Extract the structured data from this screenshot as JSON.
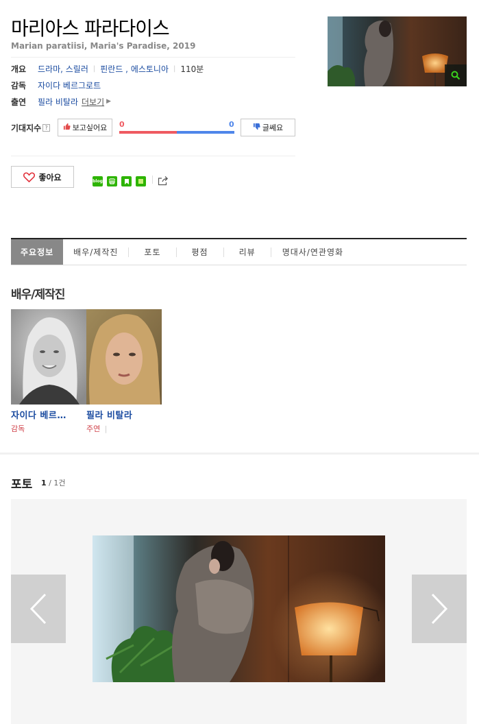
{
  "movie": {
    "title": "마리아스 파라다이스",
    "subtitle": "Marian paratiisi, Maria's Paradise, 2019"
  },
  "info": {
    "overview_label": "개요",
    "genre": "드라마, 스릴러",
    "country": "핀란드 , 에스토니아",
    "runtime": "110분",
    "director_label": "감독",
    "director": "자이다 베르그로트",
    "cast_label": "출연",
    "cast": "필라 비탈라",
    "more_label": "더보기"
  },
  "expectation": {
    "label": "기대지수",
    "help": "?",
    "want_label": "보고싶어요",
    "meh_label": "글쎄요",
    "want_count": "0",
    "meh_count": "0",
    "want_ratio": 0.5
  },
  "actions": {
    "like_label": "좋아요",
    "share_icons": [
      "blog-icon",
      "band-icon",
      "bookmark-icon",
      "memo-icon",
      "share-icon"
    ],
    "blog_text": "blog"
  },
  "tabs": [
    {
      "label": "주요정보",
      "active": true
    },
    {
      "label": "배우/제작진",
      "active": false
    },
    {
      "label": "포토",
      "active": false
    },
    {
      "label": "평점",
      "active": false
    },
    {
      "label": "리뷰",
      "active": false
    },
    {
      "label": "명대사/연관영화",
      "active": false
    }
  ],
  "cast_section": {
    "title": "배우/제작진",
    "people": [
      {
        "name": "자이다 베르…",
        "role": "감독"
      },
      {
        "name": "필라 비탈라",
        "role": "주연",
        "role_sep": "|"
      }
    ]
  },
  "photo_section": {
    "title": "포토",
    "current": "1",
    "total": "/ 1건"
  },
  "colors": {
    "link_blue": "#1a4ba0",
    "want_red": "#ef5a61",
    "meh_blue": "#4f86ea",
    "role_red": "#d0434b",
    "naver_green": "#2db400"
  }
}
